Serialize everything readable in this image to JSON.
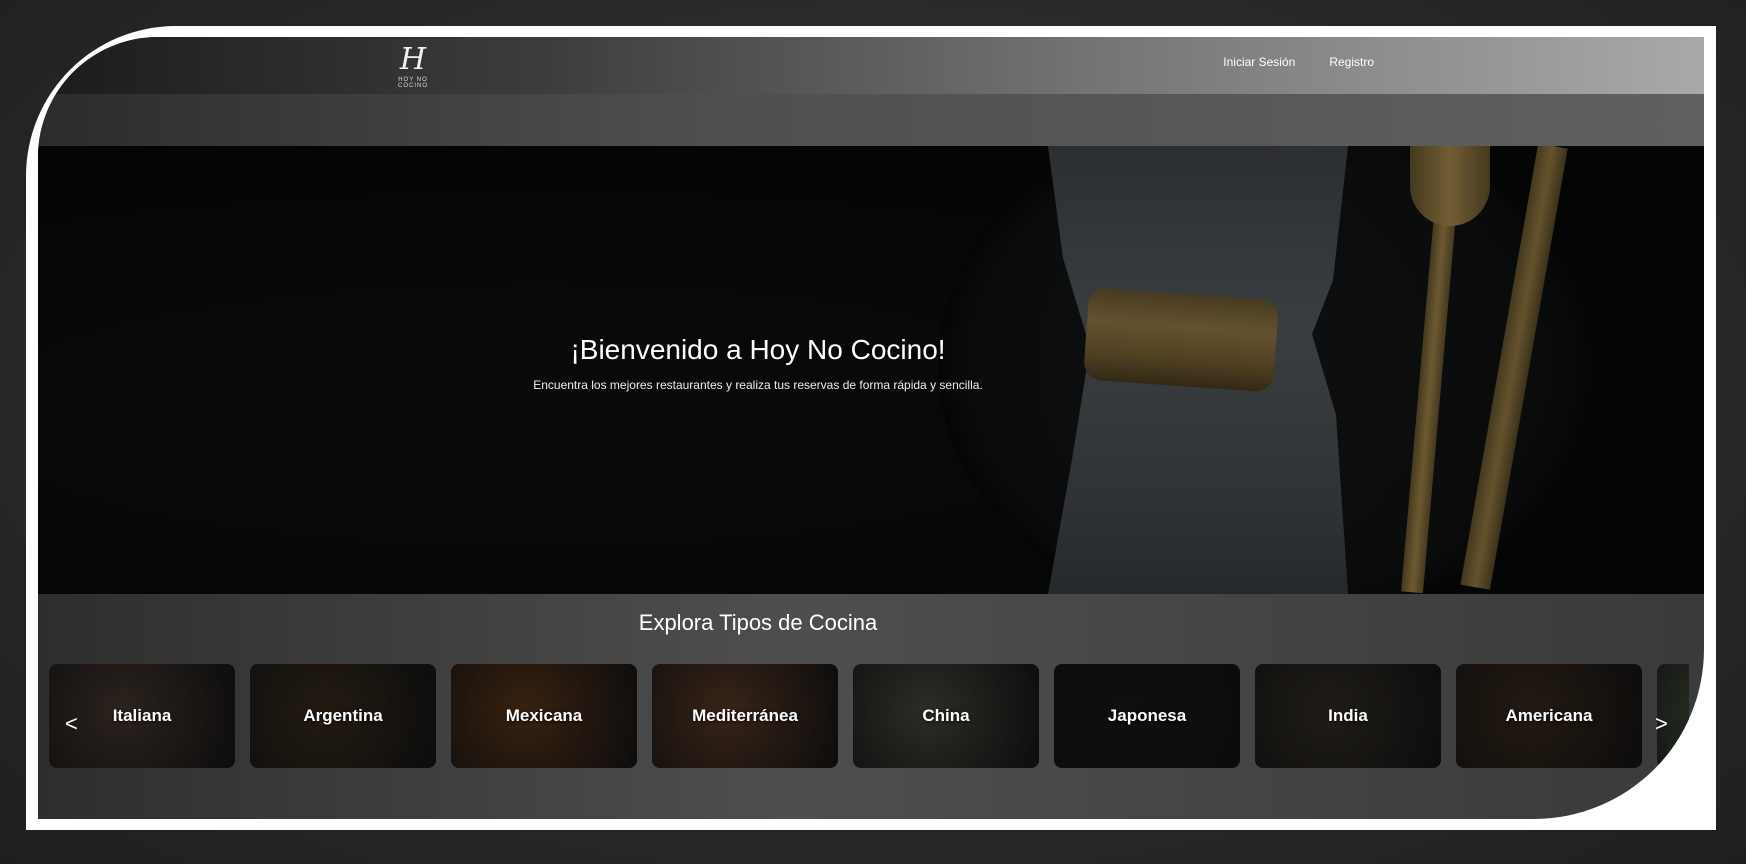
{
  "logo": {
    "mark": "H",
    "text": "HOY NO COCINO"
  },
  "nav": {
    "login": "Iniciar Sesión",
    "register": "Registro"
  },
  "hero": {
    "title": "¡Bienvenido a Hoy No Cocino!",
    "subtitle": "Encuentra los mejores restaurantes y realiza tus reservas de forma rápida y sencilla."
  },
  "cuisines": {
    "title": "Explora Tipos de Cocina",
    "prev_label": "<",
    "next_label": ">",
    "items": [
      {
        "label": "Italiana",
        "color": "#3a2f28"
      },
      {
        "label": "Argentina",
        "color": "#2e2418"
      },
      {
        "label": "Mexicana",
        "color": "#4a2c16"
      },
      {
        "label": "Mediterránea",
        "color": "#4a3020"
      },
      {
        "label": "China",
        "color": "#3b3a34"
      },
      {
        "label": "Japonesa",
        "color": "#141414"
      },
      {
        "label": "India",
        "color": "#2a2620"
      },
      {
        "label": "Americana",
        "color": "#2f2218"
      },
      {
        "label": "",
        "color": "#3d4a38"
      }
    ]
  }
}
